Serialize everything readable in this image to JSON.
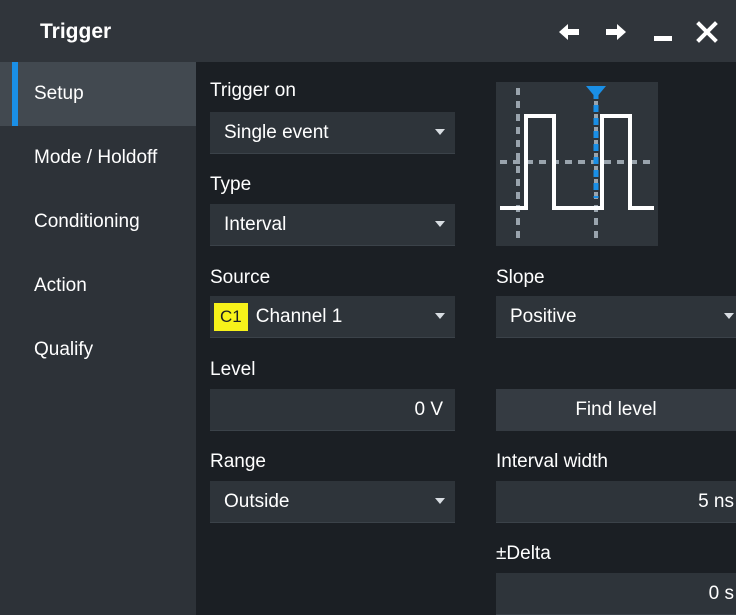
{
  "window": {
    "title": "Trigger",
    "controls": [
      "arrow-left-icon",
      "arrow-right-icon",
      "minimize-icon",
      "close-icon"
    ]
  },
  "sidebar": {
    "items": [
      {
        "label": "Setup",
        "active": true
      },
      {
        "label": "Mode / Holdoff",
        "active": false
      },
      {
        "label": "Conditioning",
        "active": false
      },
      {
        "label": "Action",
        "active": false
      },
      {
        "label": "Qualify",
        "active": false
      }
    ]
  },
  "form": {
    "trigger_on": {
      "label": "Trigger on",
      "value": "Single event"
    },
    "type": {
      "label": "Type",
      "value": "Interval"
    },
    "source": {
      "label": "Source",
      "badge": "C1",
      "value": "Channel 1"
    },
    "slope": {
      "label": "Slope",
      "value": "Positive"
    },
    "level": {
      "label": "Level",
      "value": "0 V"
    },
    "find_level": {
      "label": "Find level"
    },
    "range": {
      "label": "Range",
      "value": "Outside"
    },
    "interval_width": {
      "label": "Interval width",
      "value": "5 ns"
    },
    "delta": {
      "label": "±Delta",
      "value": "0 s"
    }
  },
  "colors": {
    "accent": "#1a8fe6",
    "channel1": "#f7f21a",
    "background": "#1b1f24",
    "titlebar": "#30353b",
    "sidebar": "#2d3238"
  }
}
